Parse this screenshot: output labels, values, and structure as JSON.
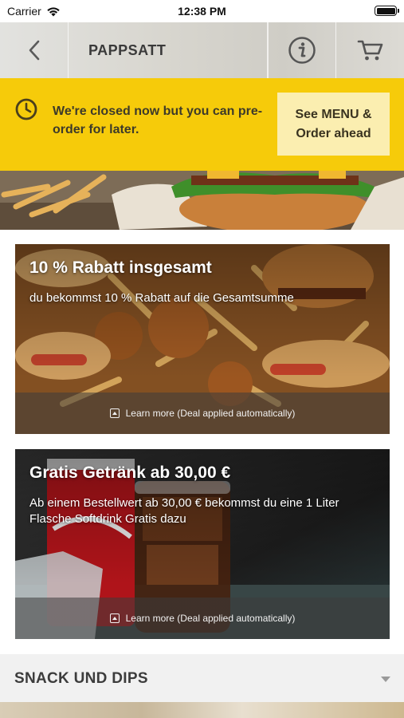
{
  "status_bar": {
    "carrier": "Carrier",
    "time": "12:38 PM"
  },
  "nav": {
    "title": "PAPPSATT",
    "back_icon": "chevron-left-icon",
    "info_icon": "info-icon",
    "cart_icon": "cart-icon"
  },
  "banner": {
    "message": "We're closed now but you can pre-order for later.",
    "cta_label": "See MENU & Order ahead",
    "icon": "clock-icon",
    "background": "#f6cb0a"
  },
  "deals": [
    {
      "title": "10 % Rabatt insgesamt",
      "description": "du bekommst 10 % Rabatt auf die Gesamtsumme",
      "learn_more": "Learn more (Deal applied automatically)"
    },
    {
      "title": "Gratis Getränk ab 30,00 €",
      "description": "Ab einem Bestellwert ab 30,00 € bekommst du eine 1 Liter Flasche Softdrink Gratis dazu",
      "learn_more": "Learn more (Deal applied automatically)"
    }
  ],
  "section": {
    "title": "SNACK UND DIPS",
    "chevron_icon": "chevron-down-icon"
  }
}
